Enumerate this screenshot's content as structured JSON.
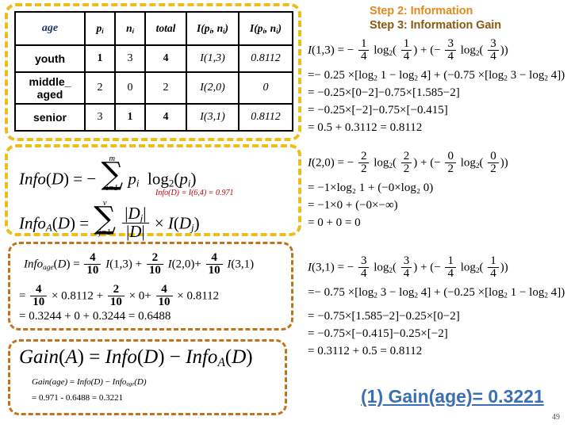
{
  "slide": {
    "page_number": "49"
  },
  "headings": {
    "step2": "Step 2: Information",
    "step3": "Step 3: Information Gain"
  },
  "table": {
    "headers": [
      "age",
      "p_i",
      "n_i",
      "total",
      "I(p_i, n_i)",
      "I(p_i, n_i)"
    ],
    "header_plain": [
      "age",
      "p",
      "n",
      "total",
      "I(p, n)",
      "I(p, n)"
    ],
    "rows": [
      {
        "age": "youth",
        "p": "1",
        "n": "3",
        "total": "4",
        "I_expr": "I(1,3)",
        "I_val": "0.8112"
      },
      {
        "age": "middle_\naged",
        "age_line1": "middle_",
        "age_line2": "aged",
        "p": "2",
        "n": "0",
        "total": "2",
        "I_expr": "I(2,0)",
        "I_val": "0"
      },
      {
        "age": "senior",
        "p": "3",
        "n": "1",
        "total": "4",
        "I_expr": "I(3,1)",
        "I_val": "0.8112"
      }
    ]
  },
  "formulas": {
    "info_d_label": "Info(D)",
    "info_d_sum_top": "m",
    "info_d_sum_bot": "i=1",
    "info_d_body": "p_i log2(p_i)",
    "info_a_label": "InfoA(D)",
    "info_a_sum_top": "v",
    "info_a_sum_bot": "j=1",
    "info_a_body": "|Dj|/|D| x I(Dj)",
    "info_d_note": "Info(D) = I(6,4) = 0.971"
  },
  "info_age_box": {
    "line1": "Infoage(D) = 4/10 I(1,3) + 2/10 I(2,0) + 4/10 I(3,1)",
    "line2": "= 4/10 x 0.8112 + 2/10 x 0 + 4/10 x 0.8112",
    "line3": "= 0.3244 + 0 + 0.3244 = 0.6488",
    "line3_text": "= 0.3244 + 0 + 0.3244 = 0.6488",
    "frac_num": "4",
    "frac_den": "10",
    "frac2_num": "2",
    "frac2_den": "10",
    "terms": [
      "I(1,3)",
      "I(2,0)",
      "I(3,1)"
    ],
    "vals": [
      "0.8112",
      "0",
      "0.8112"
    ]
  },
  "gain_box": {
    "line1": "Gain(A) = Info(D) - InfoA(D)",
    "line2": "Gain(age) = Info(D) - Infoage(D)",
    "line3": "= 0.971 - 0.6488 = 0.3221"
  },
  "i13": {
    "title": "I(1,3)",
    "line1_rest": "= -1/4 log2(1/4) + ( -3/4 log2(3/4) )",
    "line2": "= -0.25 x [log2 1 - log2 4] + ( -0.75 x [log2 3 - log2 4] )",
    "line3": "= -0.25 x [0 - 2] - 0.75 x [1.585 - 2]",
    "line4": "= -0.25 x [-2] - 0.75 x [-0.415]",
    "line5": "= 0.5 + 0.3112 = 0.8112",
    "line3_text": "= −0.25×[0−2]−0.75×[1.585−2]",
    "line4_text": "= −0.25×[−2]−0.75×[−0.415]",
    "line5_text": "= 0.5 + 0.3112 = 0.8112"
  },
  "i20": {
    "title": "I(2,0)",
    "line1_rest": "= -2/2 log2(2/2) + ( -0/2 log2(0/2) )",
    "line2_text": "= −1×log₂ 1 + (−0×log₂ 0)",
    "line3_text": "= −1×0 + (−0×−∞)",
    "line4_text": "= 0 + 0 = 0"
  },
  "i31": {
    "title": "I(3,1)",
    "line1_rest": "= -3/4 log2(3/4) + ( -1/4 log2(1/4) )",
    "line2": "= -0.75 x [log2 3 - log2 4] + ( -0.25 x [log2 1 - log2 4] )",
    "line3_text": "= −0.75×[1.585−2]−0.25×[0−2]",
    "line4_text": "= −0.75×[−0.415]−0.25×[−2]",
    "line5_text": "= 0.3112 + 0.5 = 0.8112"
  },
  "final": {
    "gain_age": "(1) Gain(age)= 0.3221"
  },
  "colors": {
    "dash_yellow": "#ebbe1b",
    "dash_orange": "#c4721a",
    "step2": "#e08a1e",
    "step3": "#8a5a12",
    "note_red": "#c00000",
    "final_blue": "#3b6fb5",
    "age_header": "#1f3864"
  }
}
